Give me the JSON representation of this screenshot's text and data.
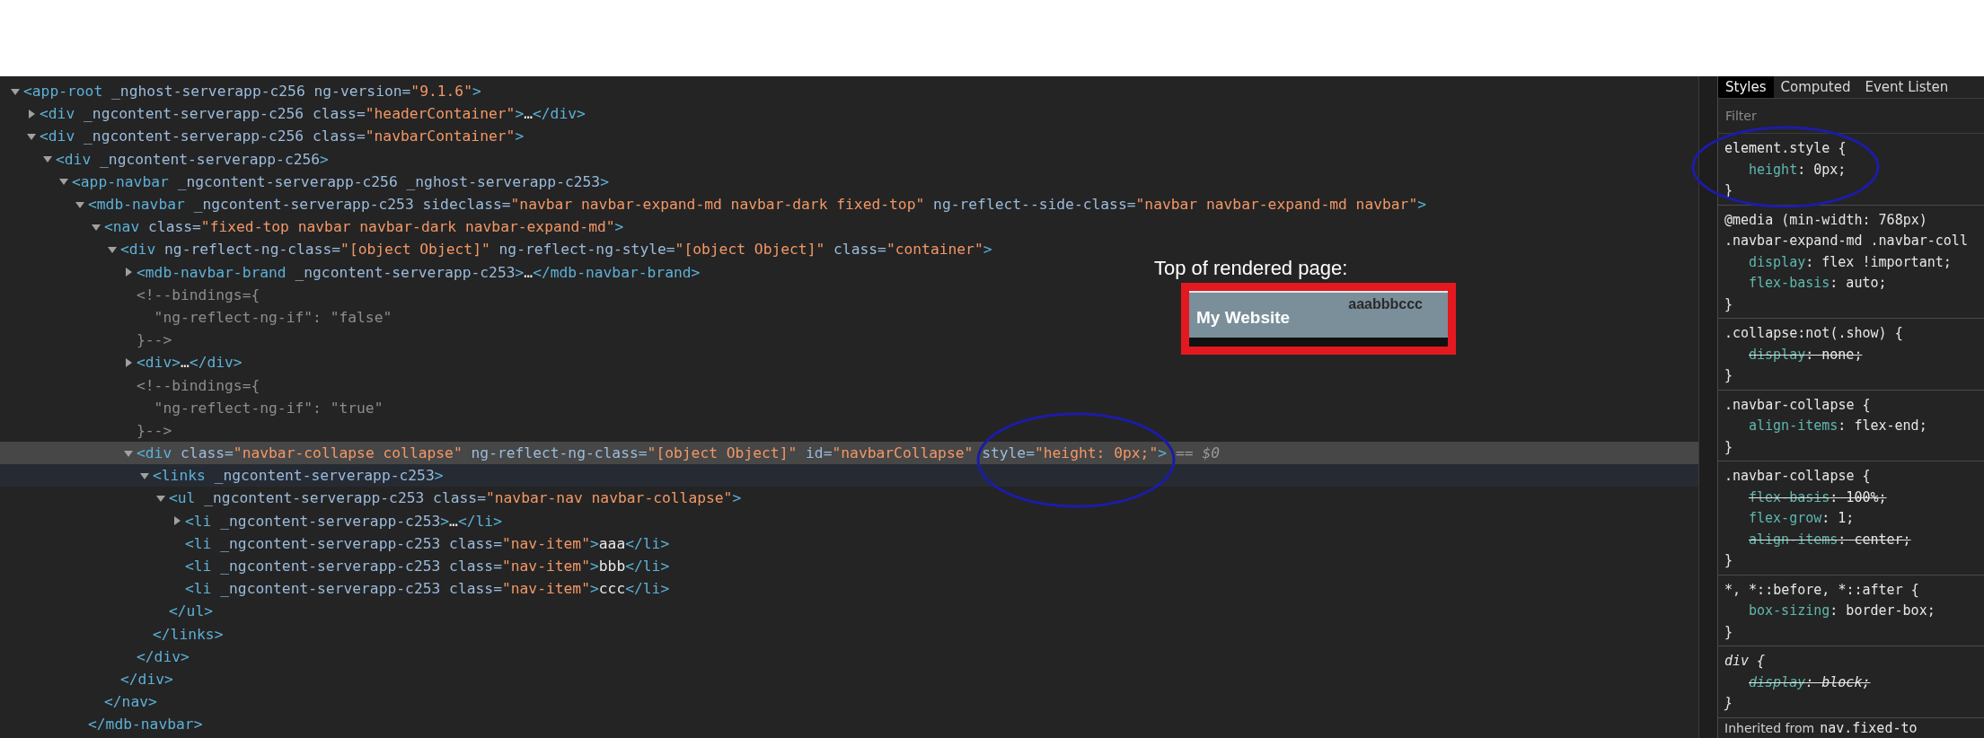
{
  "elements": {
    "tree": [
      {
        "kind": "parent",
        "text": "<app-root _nghost-serverapp-c256 ng-version=\"9.1.6\">",
        "expanded": true,
        "selected": false,
        "hovered": false,
        "children": [
          {
            "kind": "parent",
            "text": "<div _ngcontent-serverapp-c256 class=\"headerContainer\">…</div>",
            "expanded": false,
            "selected": false,
            "hovered": false
          },
          {
            "kind": "parent",
            "text": "<div _ngcontent-serverapp-c256 class=\"navbarContainer\">",
            "expanded": true,
            "selected": false,
            "hovered": false,
            "children": [
              {
                "kind": "parent",
                "text": "<div _ngcontent-serverapp-c256>",
                "expanded": true,
                "selected": false,
                "hovered": false,
                "children": [
                  {
                    "kind": "parent",
                    "text": "<app-navbar _ngcontent-serverapp-c256 _nghost-serverapp-c253>",
                    "expanded": true,
                    "selected": false,
                    "hovered": false,
                    "children": [
                      {
                        "kind": "parent",
                        "text": "<mdb-navbar _ngcontent-serverapp-c253 sideclass=\"navbar navbar-expand-md navbar-dark fixed-top\" ng-reflect--side-class=\"navbar navbar-expand-md navbar\">",
                        "expanded": true,
                        "selected": false,
                        "hovered": false,
                        "closing": "</mdb-navbar>",
                        "children": [
                          {
                            "kind": "parent",
                            "text": "<nav class=\"fixed-top navbar navbar-dark navbar-expand-md\">",
                            "expanded": true,
                            "selected": false,
                            "hovered": false,
                            "closing": "</nav>",
                            "children": [
                              {
                                "kind": "parent",
                                "text": "<div ng-reflect-ng-class=\"[object Object]\" ng-reflect-ng-style=\"[object Object]\" class=\"container\">",
                                "expanded": true,
                                "selected": false,
                                "hovered": false,
                                "closing": "</div>",
                                "children": [
                                  {
                                    "kind": "parent",
                                    "text": "<mdb-navbar-brand _ngcontent-serverapp-c253>…</mdb-navbar-brand>",
                                    "expanded": false,
                                    "selected": false,
                                    "hovered": false
                                  },
                                  {
                                    "kind": "comment",
                                    "lines": [
                                      "<!--bindings={",
                                      "\"ng-reflect-ng-if\": \"false\"",
                                      "}-->"
                                    ],
                                    "selected": false,
                                    "hovered": false
                                  },
                                  {
                                    "kind": "parent",
                                    "text": "<div>…</div>",
                                    "expanded": false,
                                    "selected": false,
                                    "hovered": false
                                  },
                                  {
                                    "kind": "comment",
                                    "lines": [
                                      "<!--bindings={",
                                      "\"ng-reflect-ng-if\": \"true\"",
                                      "}-->"
                                    ],
                                    "selected": false,
                                    "hovered": false
                                  },
                                  {
                                    "kind": "parent",
                                    "text": "<div class=\"navbar-collapse collapse\" ng-reflect-ng-class=\"[object Object]\" id=\"navbarCollapse\" style=\"height: 0px;\">",
                                    "suffix": "== $0",
                                    "expanded": true,
                                    "selected": true,
                                    "hovered": false,
                                    "closing": "</div>",
                                    "children": [
                                      {
                                        "kind": "parent",
                                        "text": "<links _ngcontent-serverapp-c253>",
                                        "expanded": true,
                                        "selected": false,
                                        "hovered": true,
                                        "closing": "</links>",
                                        "children": [
                                          {
                                            "kind": "parent",
                                            "text": "<ul _ngcontent-serverapp-c253 class=\"navbar-nav navbar-collapse\">",
                                            "expanded": true,
                                            "selected": false,
                                            "hovered": false,
                                            "closing": "</ul>",
                                            "children": [
                                              {
                                                "kind": "parent",
                                                "text": "<li _ngcontent-serverapp-c253>…</li>",
                                                "expanded": false,
                                                "selected": false,
                                                "hovered": false
                                              },
                                              {
                                                "kind": "leaf",
                                                "text": "<li _ngcontent-serverapp-c253 class=\"nav-item\">aaa</li>",
                                                "selected": false,
                                                "hovered": false
                                              },
                                              {
                                                "kind": "leaf",
                                                "text": "<li _ngcontent-serverapp-c253 class=\"nav-item\">bbb</li>",
                                                "selected": false,
                                                "hovered": false
                                              },
                                              {
                                                "kind": "leaf",
                                                "text": "<li _ngcontent-serverapp-c253 class=\"nav-item\">ccc</li>",
                                                "selected": false,
                                                "hovered": false
                                              }
                                            ]
                                          }
                                        ]
                                      }
                                    ]
                                  }
                                ]
                              }
                            ]
                          }
                        ]
                      }
                    ]
                  }
                ]
              }
            ]
          }
        ]
      }
    ]
  },
  "styles_pane": {
    "tabs": [
      {
        "label": "Styles",
        "selected": true
      },
      {
        "label": "Computed",
        "selected": false
      },
      {
        "label": "Event Listen",
        "selected": false
      }
    ],
    "filter": {
      "placeholder": "Filter"
    },
    "rules": [
      {
        "selector": [
          "element.style {"
        ],
        "user_agent": false,
        "close": "}",
        "declarations": [
          {
            "name": "height",
            "rest": ": 0px;",
            "overridden": false
          }
        ]
      },
      {
        "selector": [
          "@media (min-width: 768px)",
          ".navbar-expand-md .navbar-coll"
        ],
        "user_agent": false,
        "close": "}",
        "declarations": [
          {
            "name": "display",
            "rest": ": flex !important;",
            "overridden": false
          },
          {
            "name": "flex-basis",
            "rest": ": auto;",
            "overridden": false
          }
        ]
      },
      {
        "selector": [
          ".collapse:not(.show) {"
        ],
        "user_agent": false,
        "close": "}",
        "declarations": [
          {
            "name": "display",
            "rest": ": none;",
            "overridden": true
          }
        ]
      },
      {
        "selector": [
          ".navbar-collapse {"
        ],
        "user_agent": false,
        "close": "}",
        "declarations": [
          {
            "name": "align-items",
            "rest": ": flex-end;",
            "overridden": false
          }
        ]
      },
      {
        "selector": [
          ".navbar-collapse {"
        ],
        "user_agent": false,
        "close": "}",
        "declarations": [
          {
            "name": "flex-basis",
            "rest": ": 100%;",
            "overridden": true
          },
          {
            "name": "flex-grow",
            "rest": ": 1;",
            "overridden": false
          },
          {
            "name": "align-items",
            "rest": ": center;",
            "overridden": true
          }
        ]
      },
      {
        "selector": [
          "*, *::before, *::after {"
        ],
        "user_agent": false,
        "close": "}",
        "declarations": [
          {
            "name": "box-sizing",
            "rest": ": border-box;",
            "overridden": false
          }
        ]
      },
      {
        "selector": [
          "div {"
        ],
        "user_agent": true,
        "close": "}",
        "declarations": [
          {
            "name": "display",
            "rest": ": block;",
            "overridden": true
          }
        ]
      }
    ],
    "inherited": {
      "label": "Inherited from",
      "element": "nav.fixed-to"
    }
  },
  "annotation": {
    "caption": "Top of rendered page:",
    "preview": {
      "brand": "My Website",
      "links": "aaabbbccc"
    }
  }
}
